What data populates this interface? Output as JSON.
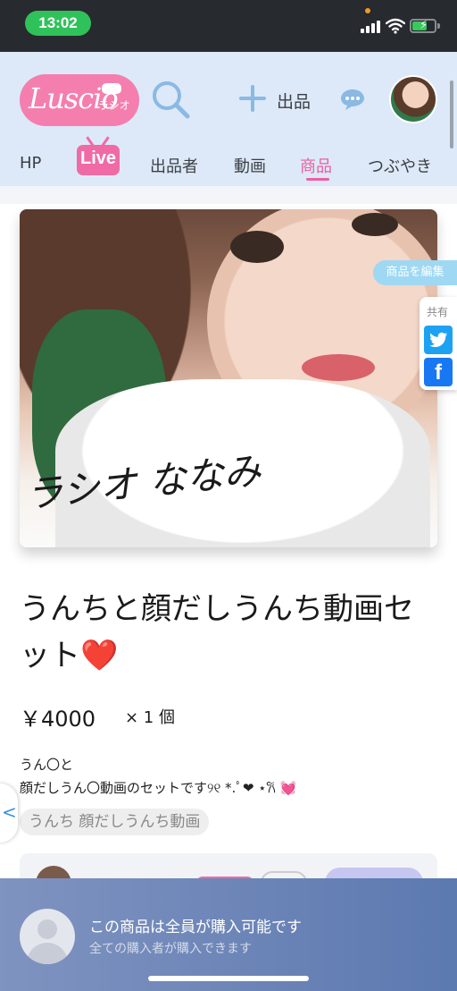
{
  "status_bar": {
    "time": "13:02"
  },
  "header": {
    "logo": "Luscio",
    "logo_sub": "ラシオ",
    "sell_label": "出品",
    "tabs": [
      {
        "label": "HP"
      },
      {
        "label": "Live"
      },
      {
        "label": "出品者"
      },
      {
        "label": "動画"
      },
      {
        "label": "商品"
      },
      {
        "label": "つぶやき"
      }
    ]
  },
  "product": {
    "image_text": "ラシオ ななみ",
    "title": "うんちと顔だしうんち動画セット",
    "title_emoji": "❤️",
    "price": "￥4000",
    "quantity": "× 1 個",
    "description_line1": "うん〇と",
    "description_line2": "顔だしうん〇動画のセットです୨୧ *.ﾟ❤︎ ⋆𐙚 💓",
    "tag": "うんち 顔だしうんち動画"
  },
  "side": {
    "edit_label": "商品を編集",
    "share_label": "共有"
  },
  "bottom": {
    "title": "この商品は全員が購入可能です",
    "subtitle": "全ての購入者が購入できます"
  },
  "colors": {
    "accent_pink": "#ec5fa0",
    "header_bg": "#dde9f8",
    "bottom_bar": "#5c79b0"
  }
}
